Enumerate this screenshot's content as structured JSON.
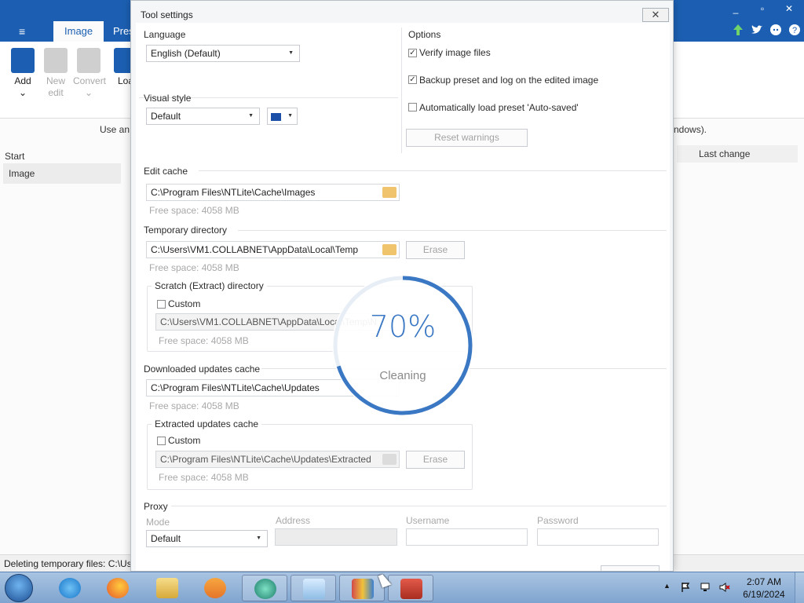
{
  "app": {
    "menu_icon": "≡",
    "tabs": [
      "Image",
      "Pres"
    ],
    "window_controls": {
      "minimize": "_",
      "maximize": "▫",
      "close": "✕"
    },
    "header_icons": [
      "up-arrow-icon",
      "twitter-icon",
      "discord-icon",
      "help-icon"
    ],
    "ribbon": {
      "add": "Add",
      "add_caret": "⌄",
      "new_edit": "New edit",
      "convert": "Convert",
      "convert_caret": "⌄",
      "load": "Loa"
    },
    "hint_left": "Use an",
    "hint_right": "ndows).",
    "left_panel": {
      "header": "Start",
      "item": "Image"
    },
    "column_header": "Last change",
    "status": "Deleting temporary files: C:\\Us"
  },
  "dialog": {
    "title": "Tool settings",
    "close_label": "✕",
    "language": {
      "label": "Language",
      "value": "English (Default)"
    },
    "visual_style": {
      "label": "Visual style",
      "value": "Default",
      "color": "#1c4fa8"
    },
    "options": {
      "label": "Options",
      "items": [
        {
          "label": "Verify image files",
          "checked": true
        },
        {
          "label": "Backup preset and log on the edited image",
          "checked": true
        },
        {
          "label": "Automatically load preset 'Auto-saved'",
          "checked": false
        }
      ],
      "reset_button": "Reset warnings"
    },
    "edit_cache": {
      "label": "Edit cache",
      "path": "C:\\Program Files\\NTLite\\Cache\\Images",
      "free_space": "Free space: 4058 MB"
    },
    "temp_dir": {
      "label": "Temporary directory",
      "path": "C:\\Users\\VM1.COLLABNET\\AppData\\Local\\Temp",
      "erase": "Erase",
      "free_space": "Free space: 4058 MB"
    },
    "scratch": {
      "label": "Scratch (Extract) directory",
      "custom": "Custom",
      "path": "C:\\Users\\VM1.COLLABNET\\AppData\\Local\\Temp\\N",
      "free_space": "Free space: 4058 MB"
    },
    "updates_cache": {
      "label": "Downloaded updates cache",
      "path": "C:\\Program Files\\NTLite\\Cache\\Updates",
      "free_space": "Free space: 4058 MB"
    },
    "extracted_updates": {
      "label": "Extracted updates cache",
      "custom": "Custom",
      "path": "C:\\Program Files\\NTLite\\Cache\\Updates\\Extracted",
      "erase": "Erase",
      "free_space": "Free space: 4058 MB"
    },
    "proxy": {
      "label": "Proxy",
      "mode_label": "Mode",
      "mode_value": "Default",
      "address_label": "Address",
      "username_label": "Username",
      "password_label": "Password"
    }
  },
  "progress": {
    "percent_text": "70%",
    "fraction": 0.7,
    "status": "Cleaning",
    "color": "#3b78c4"
  },
  "taskbar": {
    "items": [
      "internet-explorer-icon",
      "firefox-icon",
      "file-explorer-icon",
      "media-player-icon",
      "ntlite-icon",
      "notepad-icon",
      "winrar-icon",
      "toolbox-icon"
    ],
    "tray_arrow": "▲",
    "time": "2:07 AM",
    "date": "6/19/2024"
  }
}
